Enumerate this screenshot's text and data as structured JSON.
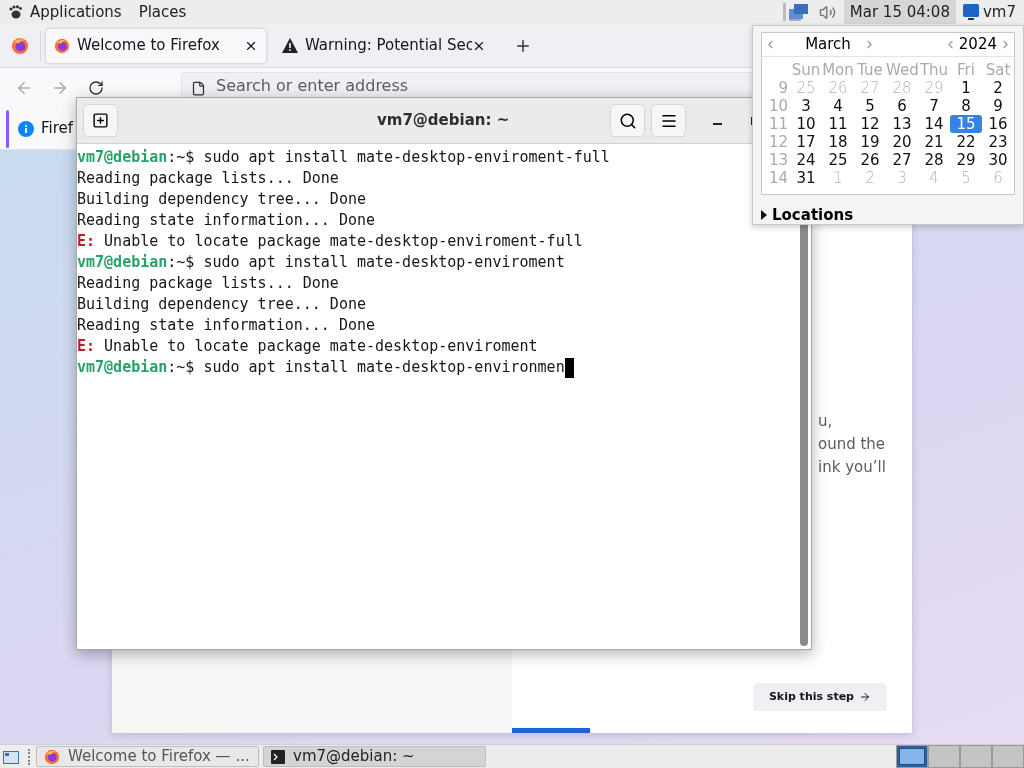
{
  "top_panel": {
    "menus": [
      "Applications",
      "Places"
    ],
    "clock": "Mar 15 04:08",
    "clock_active": true,
    "user": "vm7"
  },
  "firefox": {
    "tabs": [
      {
        "title": "Welcome to Firefox",
        "kind": "firefox",
        "selected": true
      },
      {
        "title": "Warning: Potential Sec",
        "kind": "warning",
        "selected": false
      }
    ],
    "address_placeholder": "Search or enter address",
    "notification": "Firef",
    "content_lines": [
      "u,",
      "ound the",
      "ink you’ll"
    ],
    "skip_button": "Skip this step"
  },
  "terminal": {
    "title": "vm7@debian: ~",
    "cursor_visible": true,
    "lines": [
      {
        "kind": "prompt",
        "user": "vm7@debian",
        "text": ":~$ sudo apt install mate-desktop-enviroment-full"
      },
      {
        "kind": "output",
        "text": "Reading package lists... Done"
      },
      {
        "kind": "output",
        "text": "Building dependency tree... Done"
      },
      {
        "kind": "output",
        "text": "Reading state information... Done"
      },
      {
        "kind": "error",
        "prefix": "E:",
        "text": " Unable to locate package mate-desktop-enviroment-full"
      },
      {
        "kind": "prompt",
        "user": "vm7@debian",
        "text": ":~$ sudo apt install mate-desktop-enviroment"
      },
      {
        "kind": "output",
        "text": "Reading package lists... Done"
      },
      {
        "kind": "output",
        "text": "Building dependency tree... Done"
      },
      {
        "kind": "output",
        "text": "Reading state information... Done"
      },
      {
        "kind": "error",
        "prefix": "E:",
        "text": " Unable to locate package mate-desktop-enviroment"
      },
      {
        "kind": "prompt",
        "user": "vm7@debian",
        "text": ":~$ sudo apt install mate-desktop-environmen"
      }
    ]
  },
  "calendar": {
    "month": "March",
    "year": "2024",
    "weekdays": [
      "Sun",
      "Mon",
      "Tue",
      "Wed",
      "Thu",
      "Fri",
      "Sat"
    ],
    "weeks": [
      {
        "number": "9",
        "days": [
          {
            "label": "25",
            "other_month": true,
            "selected": false
          },
          {
            "label": "26",
            "other_month": true,
            "selected": false
          },
          {
            "label": "27",
            "other_month": true,
            "selected": false
          },
          {
            "label": "28",
            "other_month": true,
            "selected": false
          },
          {
            "label": "29",
            "other_month": true,
            "selected": false
          },
          {
            "label": "1",
            "other_month": false,
            "selected": false
          },
          {
            "label": "2",
            "other_month": false,
            "selected": false
          }
        ]
      },
      {
        "number": "10",
        "days": [
          {
            "label": "3",
            "other_month": false,
            "selected": false
          },
          {
            "label": "4",
            "other_month": false,
            "selected": false
          },
          {
            "label": "5",
            "other_month": false,
            "selected": false
          },
          {
            "label": "6",
            "other_month": false,
            "selected": false
          },
          {
            "label": "7",
            "other_month": false,
            "selected": false
          },
          {
            "label": "8",
            "other_month": false,
            "selected": false
          },
          {
            "label": "9",
            "other_month": false,
            "selected": false
          }
        ]
      },
      {
        "number": "11",
        "days": [
          {
            "label": "10",
            "other_month": false,
            "selected": false
          },
          {
            "label": "11",
            "other_month": false,
            "selected": false
          },
          {
            "label": "12",
            "other_month": false,
            "selected": false
          },
          {
            "label": "13",
            "other_month": false,
            "selected": false
          },
          {
            "label": "14",
            "other_month": false,
            "selected": false
          },
          {
            "label": "15",
            "other_month": false,
            "selected": true
          },
          {
            "label": "16",
            "other_month": false,
            "selected": false
          }
        ]
      },
      {
        "number": "12",
        "days": [
          {
            "label": "17",
            "other_month": false,
            "selected": false
          },
          {
            "label": "18",
            "other_month": false,
            "selected": false
          },
          {
            "label": "19",
            "other_month": false,
            "selected": false
          },
          {
            "label": "20",
            "other_month": false,
            "selected": false
          },
          {
            "label": "21",
            "other_month": false,
            "selected": false
          },
          {
            "label": "22",
            "other_month": false,
            "selected": false
          },
          {
            "label": "23",
            "other_month": false,
            "selected": false
          }
        ]
      },
      {
        "number": "13",
        "days": [
          {
            "label": "24",
            "other_month": false,
            "selected": false
          },
          {
            "label": "25",
            "other_month": false,
            "selected": false
          },
          {
            "label": "26",
            "other_month": false,
            "selected": false
          },
          {
            "label": "27",
            "other_month": false,
            "selected": false
          },
          {
            "label": "28",
            "other_month": false,
            "selected": false
          },
          {
            "label": "29",
            "other_month": false,
            "selected": false
          },
          {
            "label": "30",
            "other_month": false,
            "selected": false
          }
        ]
      },
      {
        "number": "14",
        "days": [
          {
            "label": "31",
            "other_month": false,
            "selected": false
          },
          {
            "label": "1",
            "other_month": true,
            "selected": false
          },
          {
            "label": "2",
            "other_month": true,
            "selected": false
          },
          {
            "label": "3",
            "other_month": true,
            "selected": false
          },
          {
            "label": "4",
            "other_month": true,
            "selected": false
          },
          {
            "label": "5",
            "other_month": true,
            "selected": false
          },
          {
            "label": "6",
            "other_month": true,
            "selected": false
          }
        ]
      }
    ],
    "locations": "Locations",
    "locations_expanded": false
  },
  "taskbar": {
    "tasks": [
      {
        "title": "Welcome to Firefox — ...",
        "kind": "firefox",
        "selected": false
      },
      {
        "title": "vm7@debian: ~",
        "kind": "terminal",
        "selected": true
      }
    ],
    "workspaces": [
      {
        "selected": true
      },
      {
        "selected": false
      },
      {
        "selected": false
      },
      {
        "selected": false
      }
    ]
  }
}
